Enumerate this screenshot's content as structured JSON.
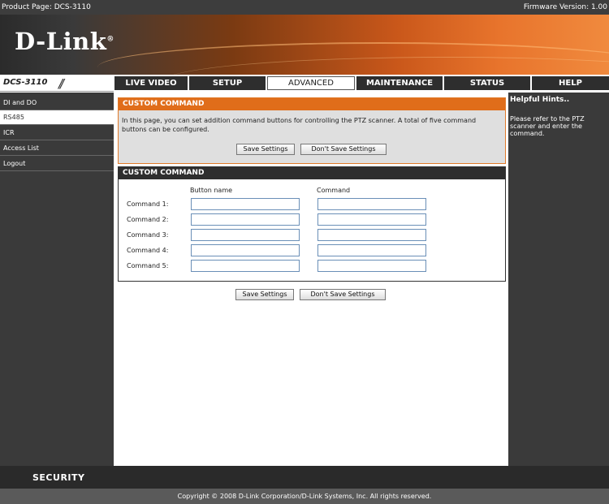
{
  "topbar": {
    "product": "Product Page: DCS-3110",
    "firmware": "Firmware Version: 1.00"
  },
  "brand": {
    "logo_text": "D-Link",
    "logo_mark": "®"
  },
  "model": {
    "label": "DCS-3110",
    "slashes": "//"
  },
  "tabs": [
    {
      "label": "LIVE VIDEO"
    },
    {
      "label": "SETUP"
    },
    {
      "label": "ADVANCED"
    },
    {
      "label": "MAINTENANCE"
    },
    {
      "label": "STATUS"
    },
    {
      "label": "HELP"
    }
  ],
  "sidebar": {
    "items": [
      {
        "label": "DI and DO"
      },
      {
        "label": "RS485"
      },
      {
        "label": "ICR"
      },
      {
        "label": "Access List"
      },
      {
        "label": "Logout"
      }
    ]
  },
  "section1": {
    "title": "CUSTOM COMMAND",
    "text": "In this page, you can set addition command buttons for controlling the PTZ scanner. A total of five command buttons can be configured.",
    "save_label": "Save Settings",
    "dont_save_label": "Don't Save Settings"
  },
  "section2": {
    "title": "CUSTOM COMMAND",
    "col_button": "Button name",
    "col_command": "Command",
    "rows": [
      {
        "label": "Command 1:",
        "button": "",
        "command": ""
      },
      {
        "label": "Command 2:",
        "button": "",
        "command": ""
      },
      {
        "label": "Command 3:",
        "button": "",
        "command": ""
      },
      {
        "label": "Command 4:",
        "button": "",
        "command": ""
      },
      {
        "label": "Command 5:",
        "button": "",
        "command": ""
      }
    ]
  },
  "bottom_buttons": {
    "save_label": "Save Settings",
    "dont_save_label": "Don't Save Settings"
  },
  "hints": {
    "title": "Helpful Hints..",
    "text": "Please refer to the PTZ scanner and enter the command."
  },
  "footer": {
    "security": "SECURITY",
    "copyright": "Copyright © 2008 D-Link Corporation/D-Link Systems, Inc. All rights reserved."
  }
}
